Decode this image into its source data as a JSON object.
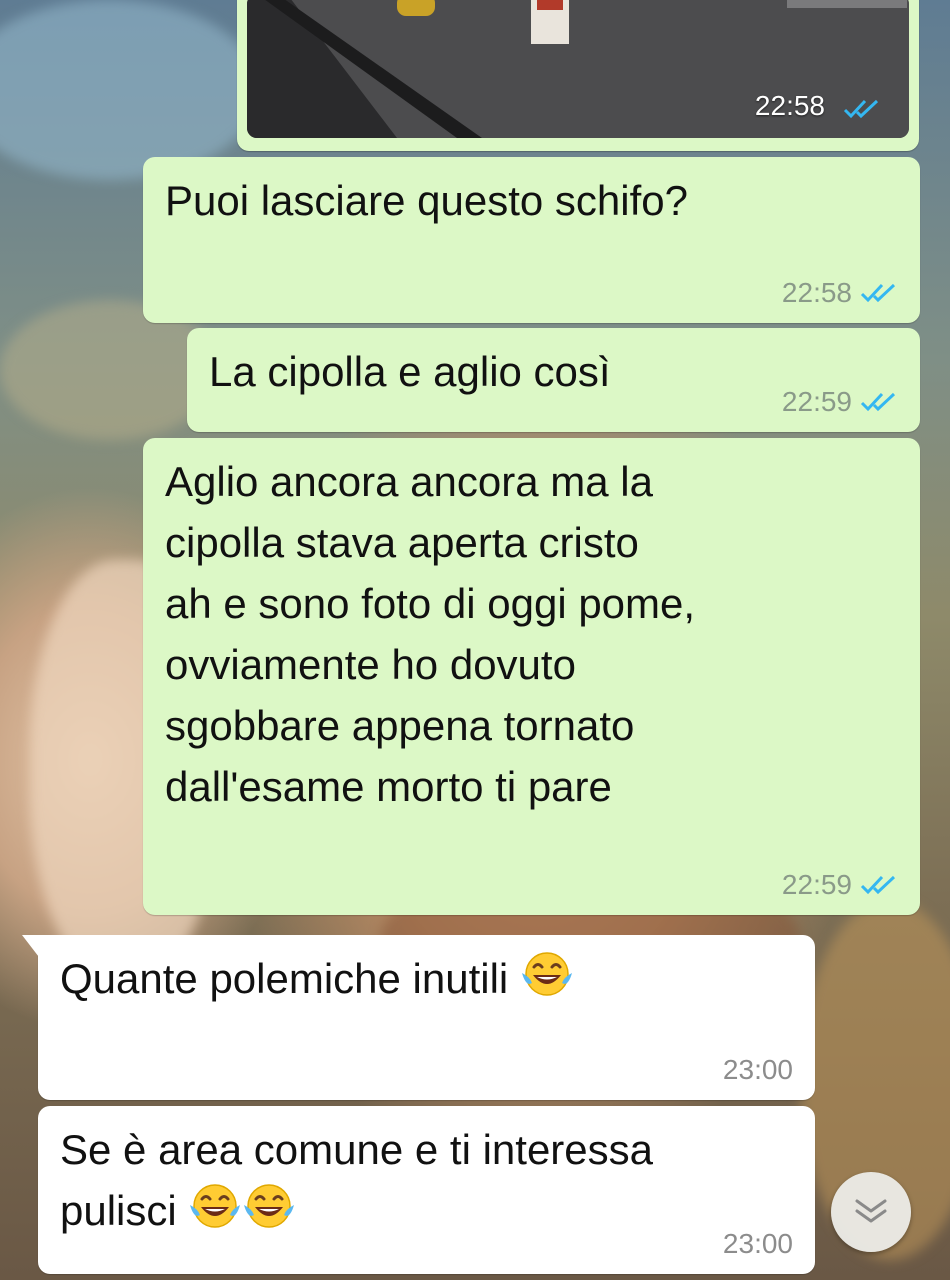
{
  "colors": {
    "outgoing_bubble": "#dcf8c6",
    "incoming_bubble": "#ffffff",
    "read_tick": "#34b7f1",
    "meta_text": "#8a9a89"
  },
  "messages": [
    {
      "direction": "outgoing",
      "type": "image",
      "time": "22:58",
      "status": "read"
    },
    {
      "direction": "outgoing",
      "text": "Puoi lasciare questo schifo?",
      "time": "22:58",
      "status": "read"
    },
    {
      "direction": "outgoing",
      "text": "La cipolla e aglio così",
      "time": "22:59",
      "status": "read"
    },
    {
      "direction": "outgoing",
      "text": "Aglio ancora ancora ma la\ncipolla stava aperta cristo\nah e sono foto di oggi pome,\novviamente ho dovuto\nsgobbare appena tornato\ndall'esame morto ti pare",
      "time": "22:59",
      "status": "read"
    },
    {
      "direction": "incoming",
      "text": "Quante polemiche inutili",
      "emoji": "face-with-tears-of-joy",
      "emoji_count": 1,
      "time": "23:00"
    },
    {
      "direction": "incoming",
      "text_line1": "Se è area comune e ti interessa",
      "text_line2": "pulisci",
      "emoji": "face-with-tears-of-joy",
      "emoji_count": 2,
      "time": "23:00"
    }
  ],
  "scroll_button": {
    "icon": "double-chevron-down-icon"
  }
}
